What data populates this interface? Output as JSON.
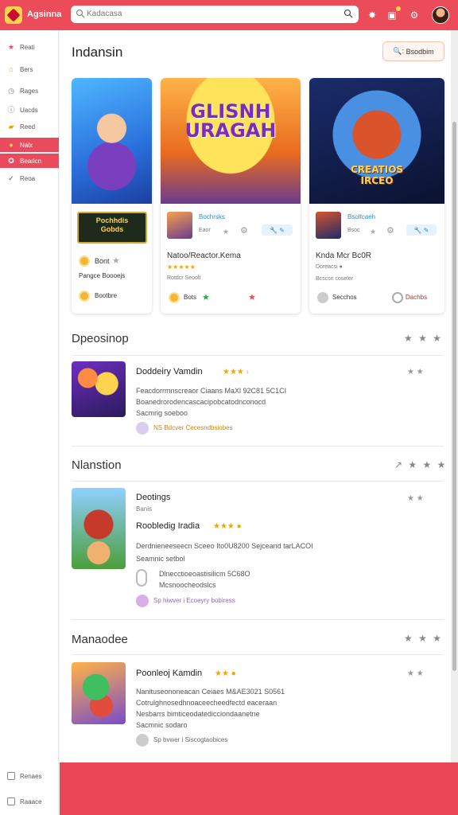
{
  "app": {
    "title": "Agsinna",
    "search_text": "Kadacasa"
  },
  "sidebar": {
    "items": [
      {
        "label": "Reati",
        "icon": "star-icon",
        "glyph": "★",
        "color": "#e94c5b"
      },
      {
        "label": "Bers",
        "icon": "home-icon",
        "glyph": "⌂",
        "color": "#f0a500"
      },
      {
        "label": "Rages",
        "icon": "clock-icon",
        "glyph": "◷",
        "color": "#777"
      },
      {
        "label": "Uacds",
        "icon": "info-icon",
        "glyph": "ⓘ",
        "color": "#777"
      },
      {
        "label": "Reed",
        "icon": "folder-icon",
        "glyph": "▰",
        "color": "#f0a500"
      },
      {
        "label": "Nalx",
        "icon": "coin-icon",
        "glyph": "●",
        "color": "#ffd34d"
      },
      {
        "label": "Bearicn",
        "icon": "gamepad-icon",
        "glyph": "✪",
        "color": "#fff"
      },
      {
        "label": "Reoa",
        "icon": "check-icon",
        "glyph": "✓",
        "color": "#555"
      }
    ],
    "bottom": [
      {
        "label": "Renaes"
      },
      {
        "label": "Raaace"
      }
    ]
  },
  "header": {
    "title": "Indansin",
    "button_label": "Bsodbim",
    "button_prefix": "🔍:"
  },
  "featured": [
    {
      "art_title": "",
      "banner": "Pochhdis\nGobds",
      "line1": "Bont",
      "line2": "Pangce Boooejs",
      "footer": "Bootbre"
    },
    {
      "art_title": "GLISNH\nURAGAH",
      "tag": "Bochrsks",
      "sub": "Eaor",
      "pill": "🔧 ✎",
      "title": "Natoo/Reactor.Kema",
      "stars": "★★★★★",
      "meta": "Rotdcr Seoolt",
      "footer": "Bots"
    },
    {
      "art_title": "CREATIOS\nIRCEO",
      "tag": "Bsoltcaeh",
      "sub": "Bsoc",
      "pill": "🔧 ✎",
      "title": "Knda Mcr Bc0R",
      "meta": "Doreacsi ●",
      "meta2": "Bcscsn coseler",
      "footer_left": "Secchos",
      "footer_right": "Dachbs"
    }
  ],
  "sections": [
    {
      "title": "Dpeosinop",
      "stars": "★ ★ ★",
      "row": {
        "title": "Doddeiry Vamdin",
        "stars": "★★★ ›",
        "lines": [
          "Feacdorrmnscreaor Ciaans MaXl 92C81 5C1CI",
          "Boanedrorodencascacipobcatodnconocd",
          "Sacmrig soeboo"
        ],
        "link": "NS Bdcver Cecesndbsiobes",
        "right_stars": "★ ★"
      }
    },
    {
      "title": "Nlanstion",
      "stars": "↗ ★ ★ ★",
      "row": {
        "title": "Deotings",
        "sub": "Banis",
        "title2": "Roobledig Iradia",
        "stars": "★★★ ●",
        "lines": [
          "Derdnieneeseecn Sceeo Ito0U8200 Sejceand tarLACOI",
          "Seamnic setbol"
        ],
        "extra_lines": [
          "Dlnecctioeoastisilicm 5C68O",
          "Mcsnoocheodslcs"
        ],
        "link": "Sp hiwver i Ecoeyry bobiress",
        "right_stars": "★ ★"
      }
    },
    {
      "title": "Manaodee",
      "stars": "★ ★ ★",
      "row": {
        "title": "Poonleoj Kamdin",
        "stars": "★★ ●",
        "lines": [
          "Nanituseononeacan Ceiaes M&AE3021 S0561",
          "Cotrulghnosedhnoaceecheedfectd eaceraan",
          "Nesbarrs bimticeodatedicciondaanetne",
          "Sacmnic sodaro"
        ],
        "link": "Sp bvwer i Siscogtaobices",
        "right_stars": "★ ★"
      }
    }
  ],
  "colors": {
    "brand": "#ec4c5a",
    "accent": "#f0a500",
    "link_blue": "#2a8fcf"
  }
}
